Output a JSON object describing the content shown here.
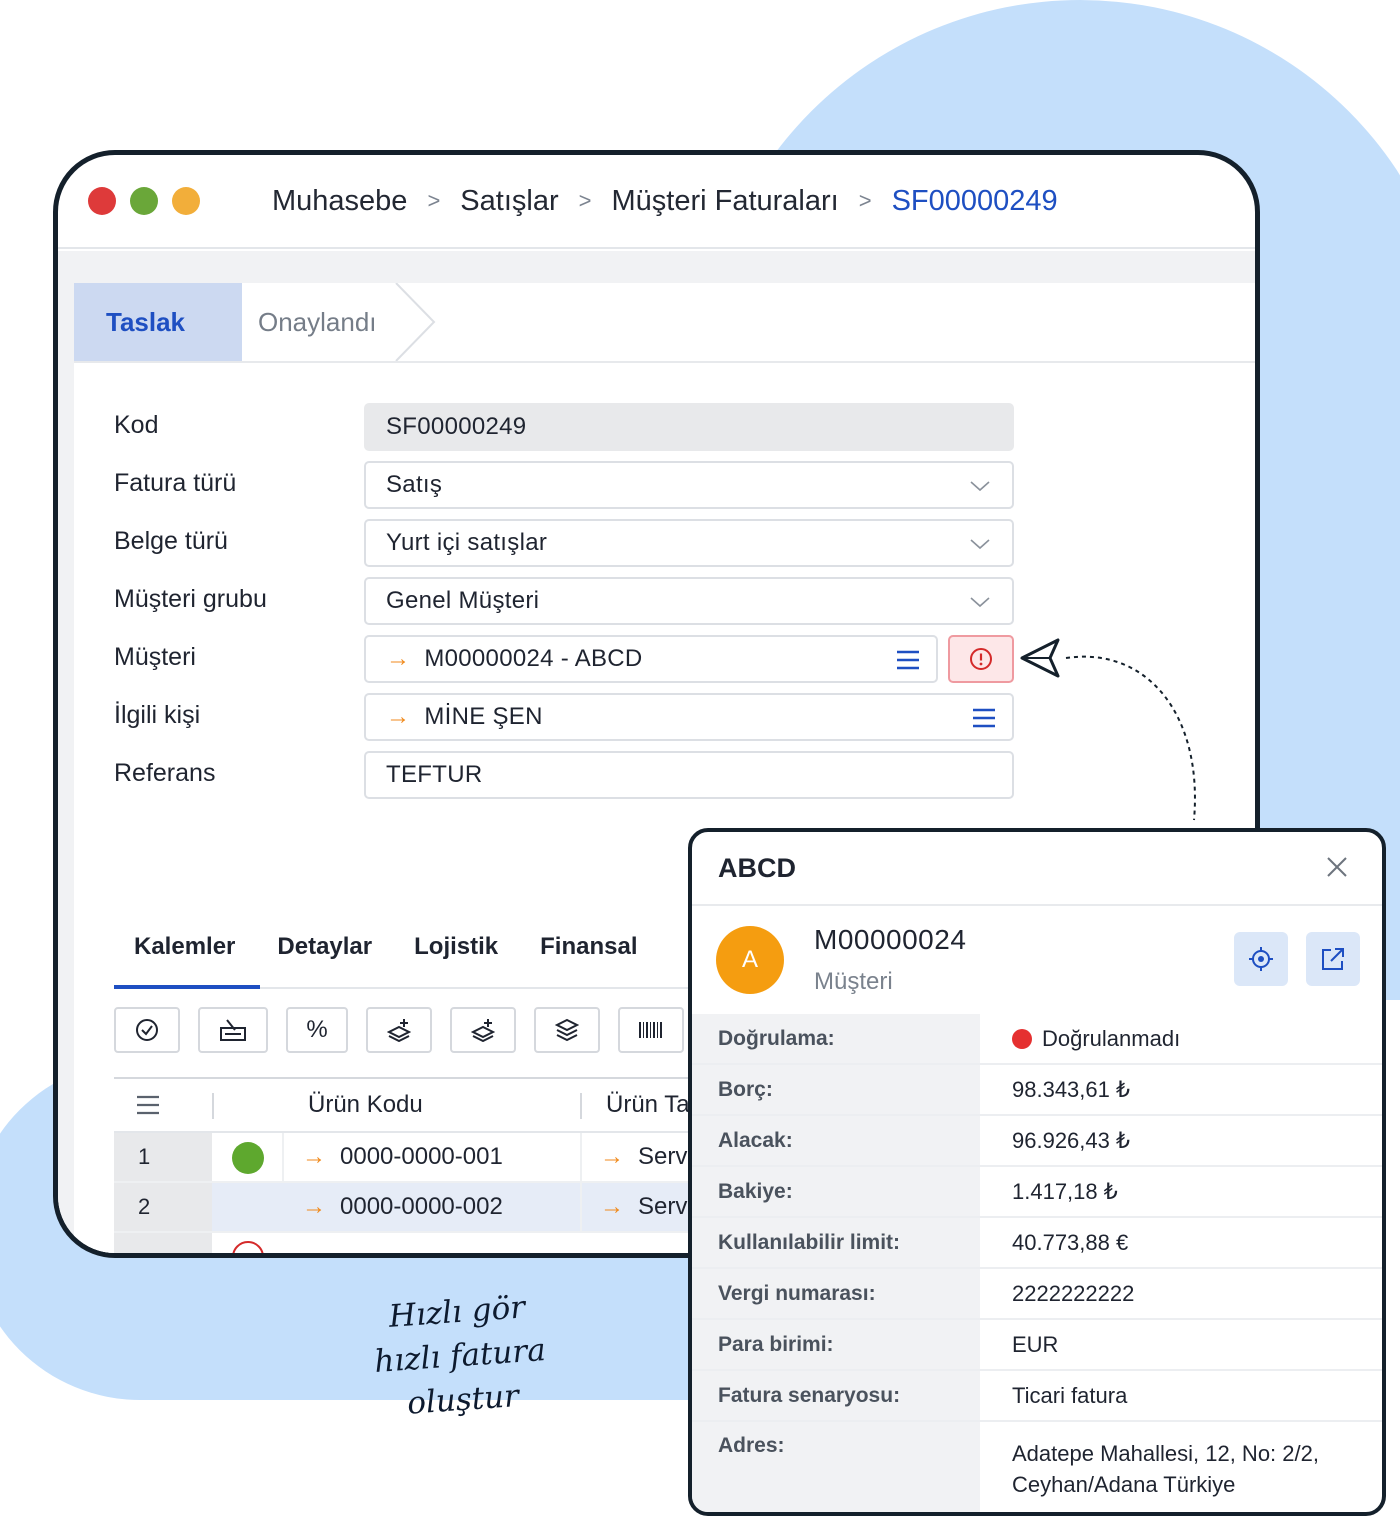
{
  "breadcrumb": [
    "Muhasebe",
    "Satışlar",
    "Müşteri Faturaları",
    "SF00000249"
  ],
  "steps": {
    "active": "Taslak",
    "next": "Onaylandı"
  },
  "form": [
    {
      "label": "Kod",
      "value": "SF00000249"
    },
    {
      "label": "Fatura türü",
      "value": "Satış"
    },
    {
      "label": "Belge türü",
      "value": "Yurt içi satışlar"
    },
    {
      "label": "Müşteri grubu",
      "value": "Genel Müşteri"
    },
    {
      "label": "Müşteri",
      "value": "M00000024 - ABCD"
    },
    {
      "label": "İlgili kişi",
      "value": "MİNE ŞEN"
    },
    {
      "label": "Referans",
      "value": "TEFTUR"
    }
  ],
  "tabs": [
    "Kalemler",
    "Detaylar",
    "Lojistik",
    "Finansal"
  ],
  "toolbar": {
    "percent": "%"
  },
  "grid": {
    "headers": [
      "Ürün Kodu",
      "Ürün Ta"
    ],
    "rows": [
      {
        "index": "1",
        "code": "0000-0000-001",
        "name": "Serv"
      },
      {
        "index": "2",
        "code": "0000-0000-002",
        "name": "Serv"
      }
    ]
  },
  "note": {
    "line1": "Hızlı gör",
    "line2": "hızlı fatura oluştur"
  },
  "popover": {
    "title": "ABCD",
    "avatar": "A",
    "id": "M00000024",
    "subtitle": "Müşteri",
    "rows": [
      {
        "label": "Doğrulama:",
        "value": "Doğrulanmadı"
      },
      {
        "label": "Borç:",
        "value": "98.343,61 ₺"
      },
      {
        "label": "Alacak:",
        "value": "96.926,43 ₺"
      },
      {
        "label": "Bakiye:",
        "value": "1.417,18 ₺"
      },
      {
        "label": "Kullanılabilir limit:",
        "value": "40.773,88 €"
      },
      {
        "label": "Vergi numarası:",
        "value": "2222222222"
      },
      {
        "label": "Para birimi:",
        "value": "EUR"
      },
      {
        "label": "Fatura senaryosu:",
        "value": "Ticari fatura"
      },
      {
        "label": "Adres:",
        "value": "Adatepe Mahallesi, 12, No: 2/2,",
        "value2": "Ceyhan/Adana Türkiye"
      }
    ]
  },
  "colors": {
    "accent": "#1e4fc2",
    "arrow": "#f08a1c",
    "blob": "#c4dffb",
    "avatar": "#f59d10",
    "status_red": "#e53030",
    "status_green": "#5ea82e"
  },
  "icons": [
    "chevron-right-icon",
    "chevron-down-icon",
    "arrow-right-icon",
    "list-icon",
    "alert-circle-icon",
    "send-icon",
    "check-circle-icon",
    "percent-icon",
    "layers-icon",
    "barcode-icon",
    "close-icon",
    "locate-icon",
    "external-link-icon"
  ]
}
